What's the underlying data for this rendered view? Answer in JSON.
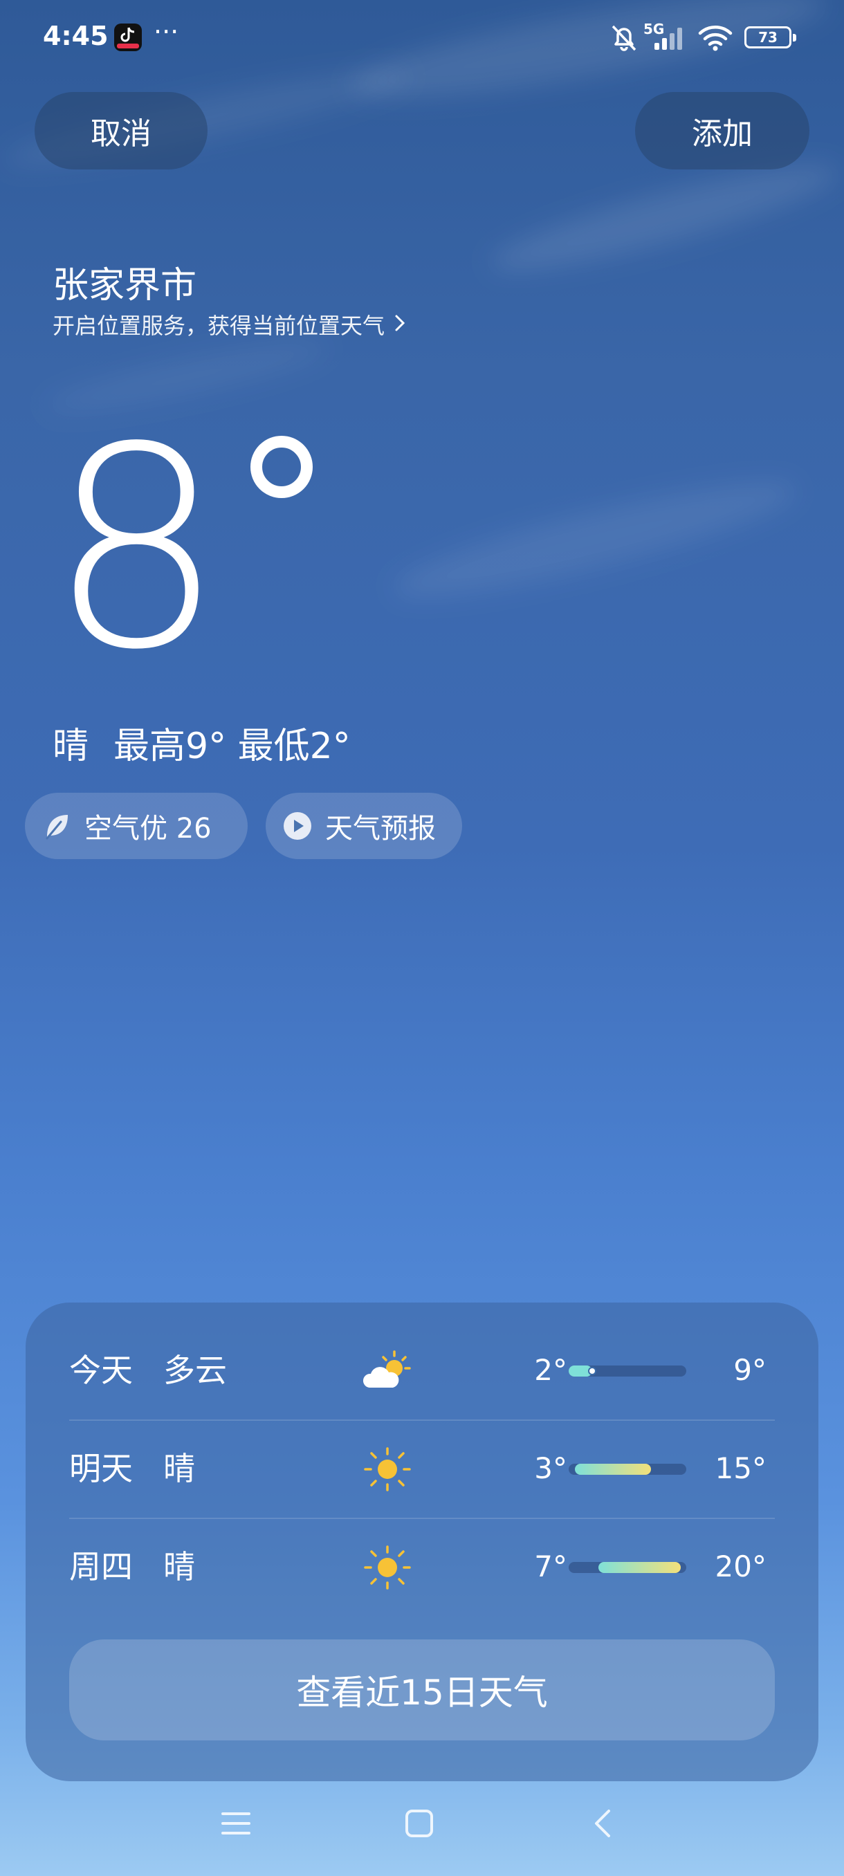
{
  "status_bar": {
    "time": "4:45",
    "more": "···",
    "network": "5G",
    "battery": "73"
  },
  "header": {
    "cancel_label": "取消",
    "add_label": "添加"
  },
  "location": {
    "city": "张家界市",
    "hint": "开启位置服务，获得当前位置天气"
  },
  "current": {
    "temperature": "8",
    "condition": "晴",
    "high_low": "最高9° 最低2°"
  },
  "chips": {
    "aqi": "空气优 26",
    "forecast": "天气预报"
  },
  "forecast": [
    {
      "day": "今天",
      "condition": "多云",
      "icon": "partly-cloudy-icon",
      "low": "2°",
      "high": "9°",
      "bar_start": 0.0,
      "bar_end": 0.2,
      "current_marker": 0.2
    },
    {
      "day": "明天",
      "condition": "晴",
      "icon": "sun-icon",
      "low": "3°",
      "high": "15°",
      "bar_start": 0.05,
      "bar_end": 0.7
    },
    {
      "day": "周四",
      "condition": "晴",
      "icon": "sun-icon",
      "low": "7°",
      "high": "20°",
      "bar_start": 0.25,
      "bar_end": 0.95
    }
  ],
  "view_15_days": "查看近15日天气",
  "colors": {
    "sky_top": "#2f5a98",
    "sky_bottom": "#9ccaf2",
    "sun": "#f7c236",
    "bar_cool": "#7fe0d8",
    "bar_warm": "#f3e07a"
  }
}
